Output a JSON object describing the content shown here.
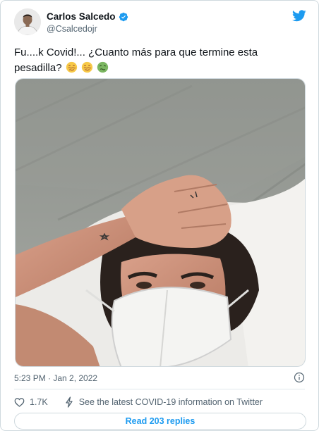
{
  "author": {
    "display_name": "Carlos Salcedo",
    "handle": "@Csalcedojr",
    "verified": true
  },
  "tweet": {
    "text": "Fu....k Covid!... ¿Cuanto más para que termine esta pesadilla?",
    "emojis": [
      "face-with-steam-hot-icon",
      "face-with-steam-hot-icon",
      "nauseated-face-icon"
    ],
    "timestamp": "5:23 PM · Jan 2, 2022"
  },
  "engagement": {
    "likes": "1.7K",
    "covid_info": "See the latest COVID-19 information on Twitter"
  },
  "replies_button": "Read 203 replies",
  "colors": {
    "twitter_blue": "#1d9bf0",
    "secondary_text": "#536471",
    "border": "#cfd9de"
  }
}
